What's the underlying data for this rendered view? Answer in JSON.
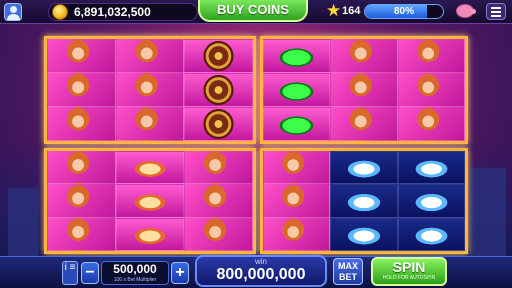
{
  "top_bar": {
    "coins": "6,891,032,500",
    "buy_coins_label": "BUY COINS",
    "level": "164",
    "xp_percent_label": "80%",
    "xp_fraction": 0.8
  },
  "slots": {
    "panels": [
      {
        "name": "top-left-machine",
        "reels": [
          [
            "girl",
            "girl",
            "girl"
          ],
          [
            "girl",
            "girl",
            "girl"
          ],
          [
            "roulette",
            "roulette",
            "roulette"
          ]
        ]
      },
      {
        "name": "top-right-machine",
        "reels": [
          [
            "car",
            "car",
            "car"
          ],
          [
            "girl",
            "girl",
            "girl"
          ],
          [
            "girl",
            "girl",
            "girl"
          ]
        ]
      },
      {
        "name": "bottom-left-machine",
        "reels": [
          [
            "girl",
            "girl",
            "girl"
          ],
          [
            "plane",
            "plane",
            "plane"
          ],
          [
            "girl",
            "girl",
            "girl"
          ]
        ]
      },
      {
        "name": "bottom-right-machine",
        "reels": [
          [
            "girl",
            "girl",
            "girl"
          ],
          [
            "yacht",
            "yacht",
            "yacht"
          ],
          [
            "yacht",
            "yacht",
            "yacht"
          ]
        ]
      }
    ]
  },
  "bottom_bar": {
    "info_label": "i ≡",
    "minus_label": "−",
    "plus_label": "+",
    "bet_value": "500,000",
    "bet_note": "100 x Bet Multiplier",
    "win_label": "win",
    "win_value": "800,000,000",
    "max_bet_label": "MAX BET",
    "spin_label": "SPIN",
    "spin_note": "HOLD FOR AUTOSPIN"
  },
  "colors": {
    "frame": "#ffb53a",
    "buy_button": "#2fa320",
    "xp_bar": "#1f5ad8"
  }
}
